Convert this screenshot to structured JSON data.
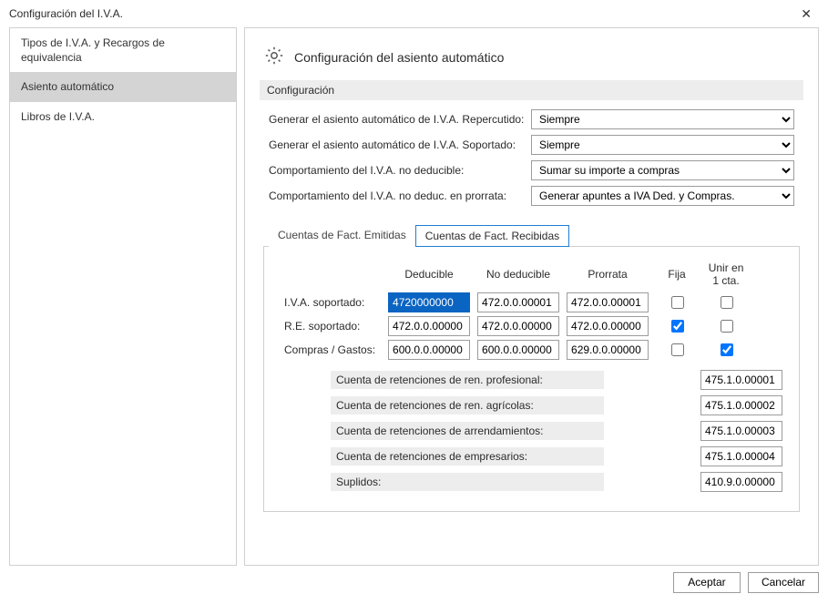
{
  "window": {
    "title": "Configuración del I.V.A."
  },
  "sidebar": {
    "items": [
      {
        "label": "Tipos de I.V.A. y Recargos de equivalencia",
        "selected": false
      },
      {
        "label": "Asiento automático",
        "selected": true
      },
      {
        "label": "Libros de I.V.A.",
        "selected": false
      }
    ]
  },
  "main": {
    "title": "Configuración del asiento automático",
    "section_label": "Configuración",
    "config_rows": [
      {
        "label": "Generar el asiento automático de I.V.A. Repercutido:",
        "value": "Siempre"
      },
      {
        "label": "Generar el asiento automático de I.V.A. Soportado:",
        "value": "Siempre"
      },
      {
        "label": "Comportamiento del I.V.A. no deducible:",
        "value": "Sumar su importe a compras"
      },
      {
        "label": "Comportamiento del I.V.A. no deduc. en prorrata:",
        "value": "Generar apuntes a IVA Ded. y Compras."
      }
    ],
    "tabs": [
      {
        "label": "Cuentas de Fact. Emitidas",
        "active": false
      },
      {
        "label": "Cuentas de Fact. Recibidas",
        "active": true
      }
    ],
    "grid": {
      "headers": [
        "Deducible",
        "No deducible",
        "Prorrata",
        "Fija",
        "Unir en 1 cta."
      ],
      "rows": [
        {
          "label": "I.V.A. soportado:",
          "c1": "4720000000",
          "c1_selected": true,
          "c2": "472.0.0.00001",
          "c3": "472.0.0.00001",
          "fija": false,
          "unir": false
        },
        {
          "label": "R.E. soportado:",
          "c1": "472.0.0.00000",
          "c1_selected": false,
          "c2": "472.0.0.00000",
          "c3": "472.0.0.00000",
          "fija": true,
          "unir": false
        },
        {
          "label": "Compras / Gastos:",
          "c1": "600.0.0.00000",
          "c1_selected": false,
          "c2": "600.0.0.00000",
          "c3": "629.0.0.00000",
          "fija": false,
          "unir": true
        }
      ]
    },
    "retentions": [
      {
        "label": "Cuenta de retenciones de ren. profesional:",
        "value": "475.1.0.00001"
      },
      {
        "label": "Cuenta de retenciones de ren. agrícolas:",
        "value": "475.1.0.00002"
      },
      {
        "label": "Cuenta de retenciones de arrendamientos:",
        "value": "475.1.0.00003"
      },
      {
        "label": "Cuenta de retenciones de empresarios:",
        "value": "475.1.0.00004"
      },
      {
        "label": "Suplidos:",
        "value": "410.9.0.00000"
      }
    ]
  },
  "footer": {
    "ok": "Aceptar",
    "cancel": "Cancelar"
  }
}
